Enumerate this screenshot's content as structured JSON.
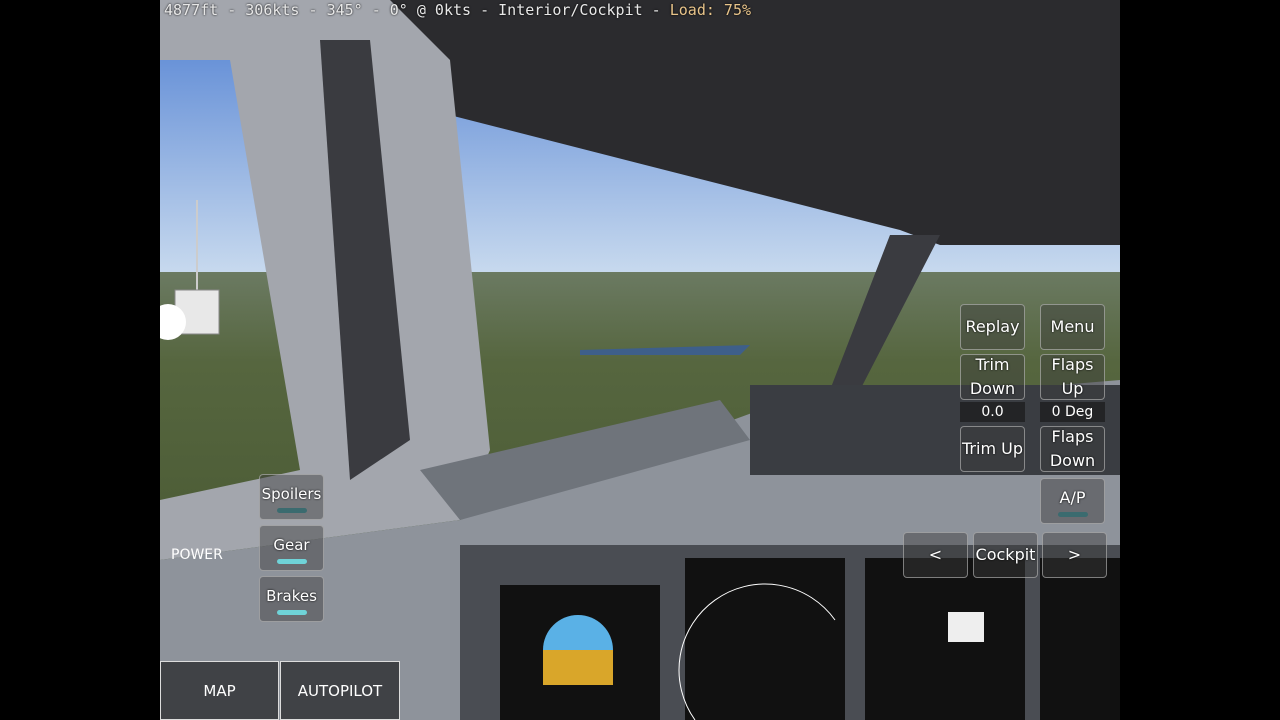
{
  "hud": {
    "altitude": "4877ft",
    "speed": "306kts",
    "heading": "345°",
    "wind": "0° @ 0kts",
    "view": "Interior/Cockpit",
    "load_label": "Load: 75%",
    "load_percent": 75,
    "sep": " - "
  },
  "controls": {
    "replay": "Replay",
    "menu": "Menu",
    "trim_down_1": "Trim",
    "trim_down_2": "Down",
    "trim_value": "0.0",
    "trim_up": "Trim Up",
    "flaps_up_1": "Flaps",
    "flaps_up_2": "Up",
    "flaps_value": "0 Deg",
    "flaps_down_1": "Flaps",
    "flaps_down_2": "Down",
    "autopilot": "A/P",
    "prev_view": "<",
    "view_name": "Cockpit",
    "next_view": ">",
    "spoilers": "Spoilers",
    "gear": "Gear",
    "brakes": "Brakes",
    "power": "POWER",
    "map": "MAP",
    "autopilot_panel": "AUTOPILOT"
  },
  "colors": {
    "sky_top": "#5a87d6",
    "sky_horizon": "#c9dcee",
    "ground": "#56663f",
    "indicator_on": "#6fd3d8",
    "load": "#e8c48a"
  }
}
